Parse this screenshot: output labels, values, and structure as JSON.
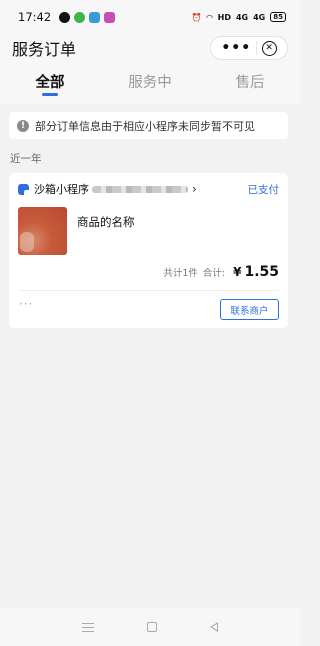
{
  "status_bar": {
    "time": "17:42",
    "network_label": "HD",
    "signal_1": "4G",
    "signal_2": "4G",
    "battery": "85"
  },
  "header": {
    "title": "服务订单",
    "more_label": "•••",
    "close_label": "✕"
  },
  "tabs": [
    {
      "label": "全部",
      "active": true
    },
    {
      "label": "服务中",
      "active": false
    },
    {
      "label": "售后",
      "active": false
    }
  ],
  "notice": {
    "icon_label": "!",
    "text": "部分订单信息由于相应小程序未同步暂不可见"
  },
  "section_label": "近一年",
  "order": {
    "app_name": "沙箱小程序",
    "status": "已支付",
    "product_name": "商品的名称",
    "count_text": "共计1件",
    "total_label": "合计:",
    "currency": "¥",
    "amount": "1.55",
    "more_dots": "···",
    "contact_label": "联系商户"
  },
  "colors": {
    "accent": "#2f6ee0",
    "background": "#f2f2f2"
  }
}
